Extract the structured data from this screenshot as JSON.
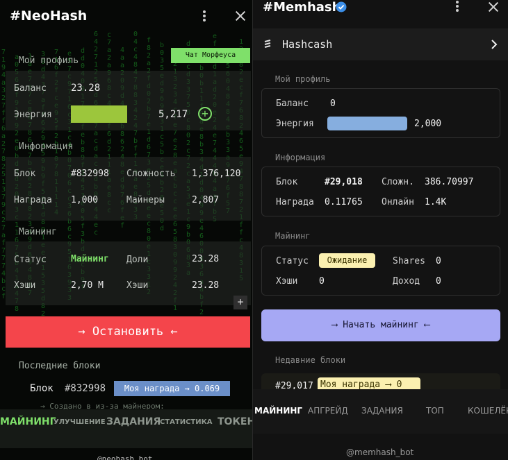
{
  "left": {
    "title": "#NeoHash",
    "chat_button": "Чат Морфеуса",
    "profile": {
      "section": "Мой профиль",
      "balance_label": "Баланс",
      "balance_value": "23.28",
      "energy_label": "Энергия",
      "energy_value": "5,217",
      "energy_plus": "+"
    },
    "info": {
      "section": "Информация",
      "block_label": "Блок",
      "block_value": "#832998",
      "difficulty_label": "Сложность",
      "difficulty_value": "1,376,120",
      "reward_label": "Награда",
      "reward_value": "1,000",
      "miners_label": "Майнеры",
      "miners_value": "2,807"
    },
    "mining": {
      "section": "Майнинг",
      "status_label": "Статус",
      "status_value": "Майнинг",
      "shares_label": "Доли",
      "shares_value": "23.28",
      "hashes_label": "Хэши",
      "hashes_value": "2,70 M",
      "hashes2_label": "Хэши",
      "hashes2_value": "23.28",
      "plus": "+"
    },
    "stop_button": "→ Остановить ←",
    "recent": {
      "section": "Последние блоки",
      "block_label": "Блок",
      "block_value": "#832998",
      "reward_badge": "Моя награда → 0.069",
      "cut_line": "→ Создано в из-за майнером:"
    },
    "nav": [
      "МАЙНИНГ",
      "УЛУЧШЕНИЕ",
      "ЗАДАНИЯ",
      "СТАТИСТИКА",
      "ТОКЕН"
    ],
    "footer": "@neohash_bot"
  },
  "right": {
    "title": "#Memhash",
    "hashcash_label": "Hashcash",
    "profile": {
      "section": "Мой профиль",
      "balance_label": "Баланс",
      "balance_value": "0",
      "energy_label": "Энергия",
      "energy_value": "2,000"
    },
    "info": {
      "section": "Информация",
      "block_label": "Блок",
      "block_value": "#29,018",
      "diff_label": "Сложн.",
      "diff_value": "386.70997",
      "reward_label": "Награда",
      "reward_value": "0.11765",
      "online_label": "Онлайн",
      "online_value": "1.4K"
    },
    "mining": {
      "section": "Майнинг",
      "status_label": "Статус",
      "status_value": "Ожидание",
      "shares_label": "Shares",
      "shares_value": "0",
      "hashes_label": "Хэши",
      "hashes_value": "0",
      "income_label": "Доход",
      "income_value": "0"
    },
    "start_button": "⟶ Начать майнинг ⟵",
    "recent": {
      "section": "Недавние блоки",
      "block_value": "#29,017",
      "reward": "Моя награда ⟶ 0"
    },
    "nav": [
      "МАЙНИНГ",
      "АПГРЕЙД",
      "ЗАДАНИЯ",
      "ТОП",
      "КОШЕЛЁК"
    ],
    "footer": "@memhash_bot"
  },
  "colors": {
    "matrix_green": "#1e9d2a",
    "neon_green": "#7fe06a",
    "stop_red": "#f4454b",
    "energy_lime": "#9cc63c",
    "reward_blue": "#6b8fc8",
    "memhash_energy": "#86aedf",
    "memhash_button": "#a6a8f4",
    "badge_yellow": "#fbf0b0",
    "verified_blue": "#3b8ee8"
  }
}
